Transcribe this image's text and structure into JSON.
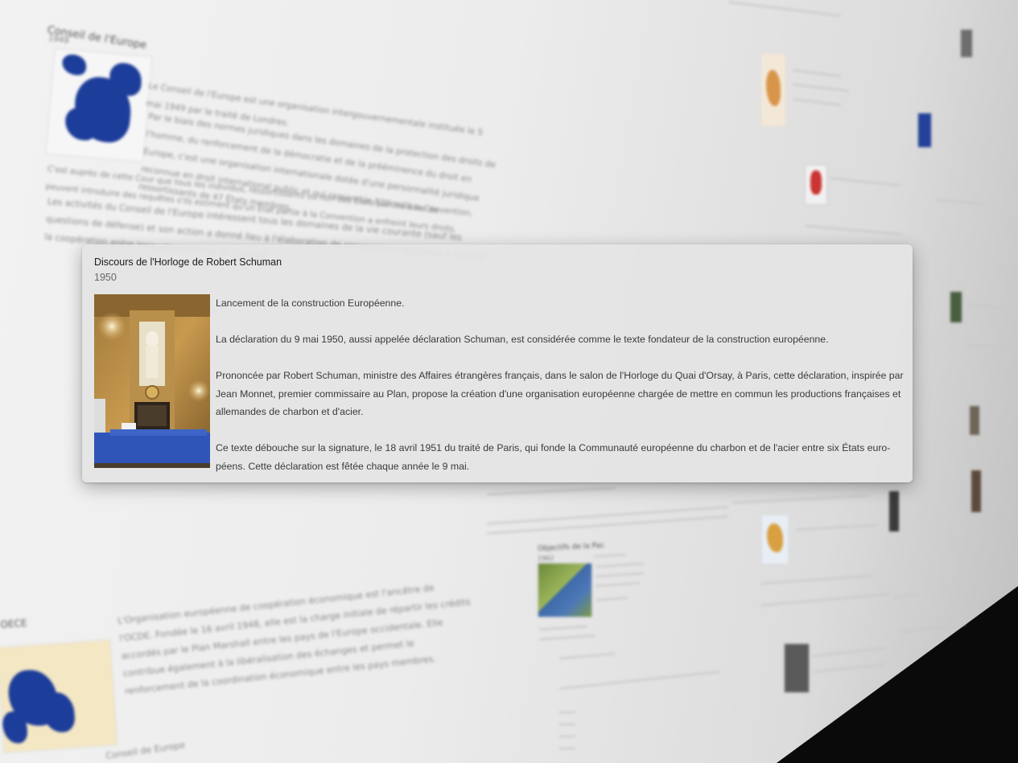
{
  "background": {
    "section_top": {
      "title": "Conseil de l'Europe",
      "year": "1949",
      "paragraphs": [
        "Le Conseil de l'Europe est une organisation intergouvernementale instituée le 5 mai 1949 par le traité de Londres.",
        "Par le biais des normes juridiques dans les domaines de la protection des droits de l'homme, du renforcement de la démocratie et de la prééminence du droit en Europe, c'est une organisation internationale dotée d'une personnalité juridique reconnue en droit international public et qui rassemble 820 millions de ressortissants de 47 États membres.",
        "C'est auprès de cette Cour que tous les individus, ressortissants ou non des États parties à la Convention, peuvent introduire des requêtes s'ils estiment qu'un État partie à la Convention a enfreint leurs droits.",
        "Les activités du Conseil de l'Europe intéressent tous les domaines de la vie courante (sauf les questions de défense) et son action a donné lieu à l'élaboration de conventions destinées à faciliter la coopération entre lesquels membres du Conseil."
      ]
    },
    "section_bottom": {
      "title": "OECE",
      "paragraphs": [
        "L'Organisation européenne de coopération économique est l'ancêtre de l'OCDE. Fondée le 16 avril 1948, elle est la charge initiale de répartir les crédits accordés par le Plan Marshall entre les pays de l'Europe occidentale. Elle contribue également à la libéralisation des échanges et permet le renforcement de la coordination économique entre les pays membres.",
        "Conseil de Europe"
      ]
    },
    "section_mid": {
      "title": "Objectifs de la Pac",
      "year": "1962"
    }
  },
  "popup": {
    "title": "Discours de l'Horloge de Robert Schuman",
    "year": "1950",
    "paragraphs": [
      "Lancement de la construction Européenne.",
      "La déclaration du 9 mai 1950, aussi appelée déclaration Schuman, est considérée comme le texte fondateur de la construction européenne.",
      "Prononcée par Robert Schuman, ministre des Affaires étrangères français, dans le salon de l'Horloge du Quai d'Orsay, à Paris, cette déclaration, inspirée par Jean Monnet, premier commissaire au Plan, propose la création d'une organisation européenne chargée de mettre en commun les productions françaises et allemandes de charbon et d'acier.",
      "Ce texte débouche sur la signature, le 18 avril 1951 du traité de Paris, qui fonde la Communauté européenne du charbon et de l'acier entre six États euro-péens. Cette déclaration est fêtée chaque année le 9 mai."
    ],
    "photo_icon": "salon-horloge-photo"
  },
  "colors": {
    "map_blue": "#1d3d9a",
    "popup_bg": "#e4e4e4",
    "title_text": "#1a1a1a",
    "body_text": "#3a3a3a"
  }
}
